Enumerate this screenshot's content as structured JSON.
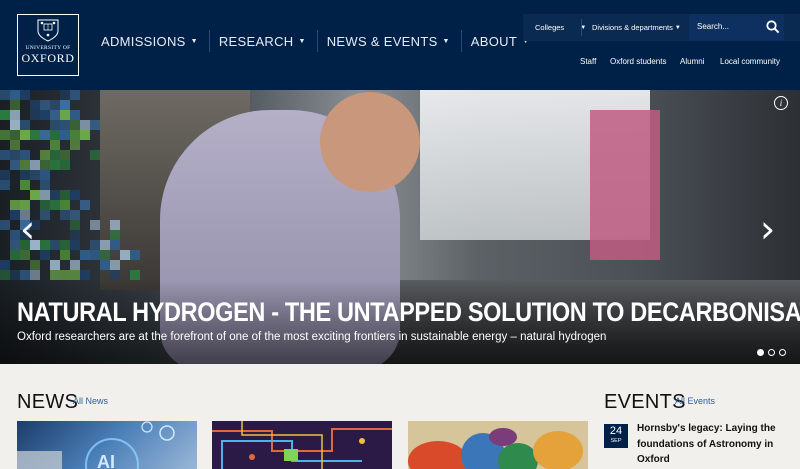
{
  "logo": {
    "line1": "UNIVERSITY OF",
    "line2": "OXFORD"
  },
  "main_nav": [
    {
      "label": "ADMISSIONS"
    },
    {
      "label": "RESEARCH"
    },
    {
      "label": "NEWS & EVENTS"
    },
    {
      "label": "ABOUT"
    }
  ],
  "top_nav": {
    "colleges": "Colleges",
    "divisions": "Divisions & departments",
    "search_placeholder": "Search..."
  },
  "audience_links": [
    "Staff",
    "Oxford students",
    "Alumni",
    "Local community"
  ],
  "hero": {
    "title": "NATURAL HYDROGEN - THE UNTAPPED SOLUTION TO DECARBONISATION?",
    "subtitle": "Oxford researchers are at the forefront of one of the most exciting frontiers in sustainable energy – natural hydrogen",
    "slides": 3,
    "active_slide": 1
  },
  "news": {
    "title": "NEWS",
    "link": "All News"
  },
  "events": {
    "title": "EVENTS",
    "link": "All Events",
    "items": [
      {
        "day": "24",
        "month": "SEP",
        "title": "Hornsby's legacy: Laying the foundations of Astronomy in Oxford"
      }
    ]
  },
  "colors": {
    "navy": "#002147",
    "page_bg": "#f2f0ec",
    "link": "#2b5fa0"
  }
}
